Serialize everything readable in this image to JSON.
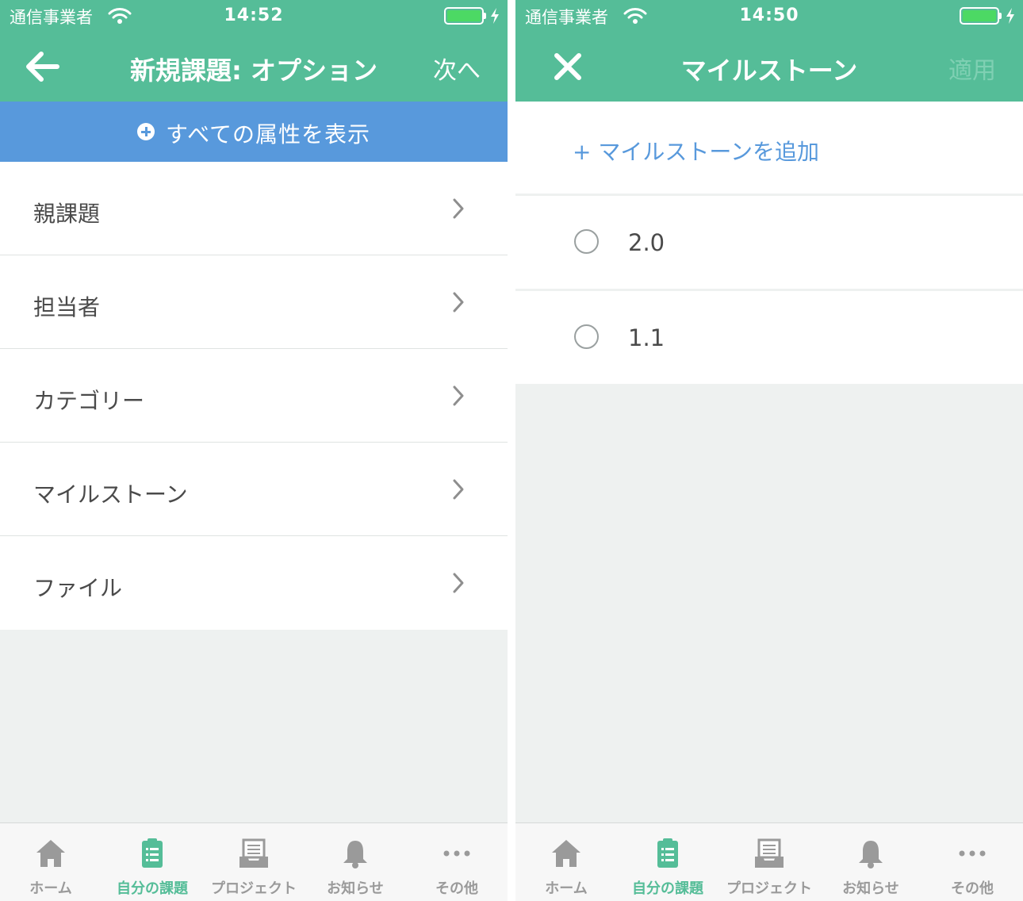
{
  "left_screen": {
    "status": {
      "carrier": "通信事業者",
      "time": "14:52"
    },
    "nav": {
      "title": "新規課題: オプション",
      "right": "次へ",
      "left_icon": "back-arrow-icon"
    },
    "show_all_attributes": "すべての属性を表示",
    "items": [
      {
        "label": "親課題"
      },
      {
        "label": "担当者"
      },
      {
        "label": "カテゴリー"
      },
      {
        "label": "マイルストーン"
      },
      {
        "label": "ファイル"
      }
    ]
  },
  "right_screen": {
    "status": {
      "carrier": "通信事業者",
      "time": "14:50"
    },
    "nav": {
      "title": "マイルストーン",
      "right": "適用",
      "left_icon": "close-icon"
    },
    "add_milestone": "+ マイルストーンを追加",
    "options": [
      {
        "label": "2.0"
      },
      {
        "label": "1.1"
      }
    ]
  },
  "tabbar": {
    "tabs": [
      {
        "label": "ホーム",
        "icon": "home-icon"
      },
      {
        "label": "自分の課題",
        "icon": "clipboard-icon",
        "active": true
      },
      {
        "label": "プロジェクト",
        "icon": "inbox-tray-icon"
      },
      {
        "label": "お知らせ",
        "icon": "bell-icon"
      },
      {
        "label": "その他",
        "icon": "more-dots-icon"
      }
    ]
  },
  "colors": {
    "header_green": "#55bd98",
    "show_attr_blue": "#5899dc",
    "link_blue": "#5899dc",
    "background_gray": "#eef1f0",
    "tab_inactive": "#9a9a9a",
    "apply_disabled": "#7fd0b3"
  }
}
